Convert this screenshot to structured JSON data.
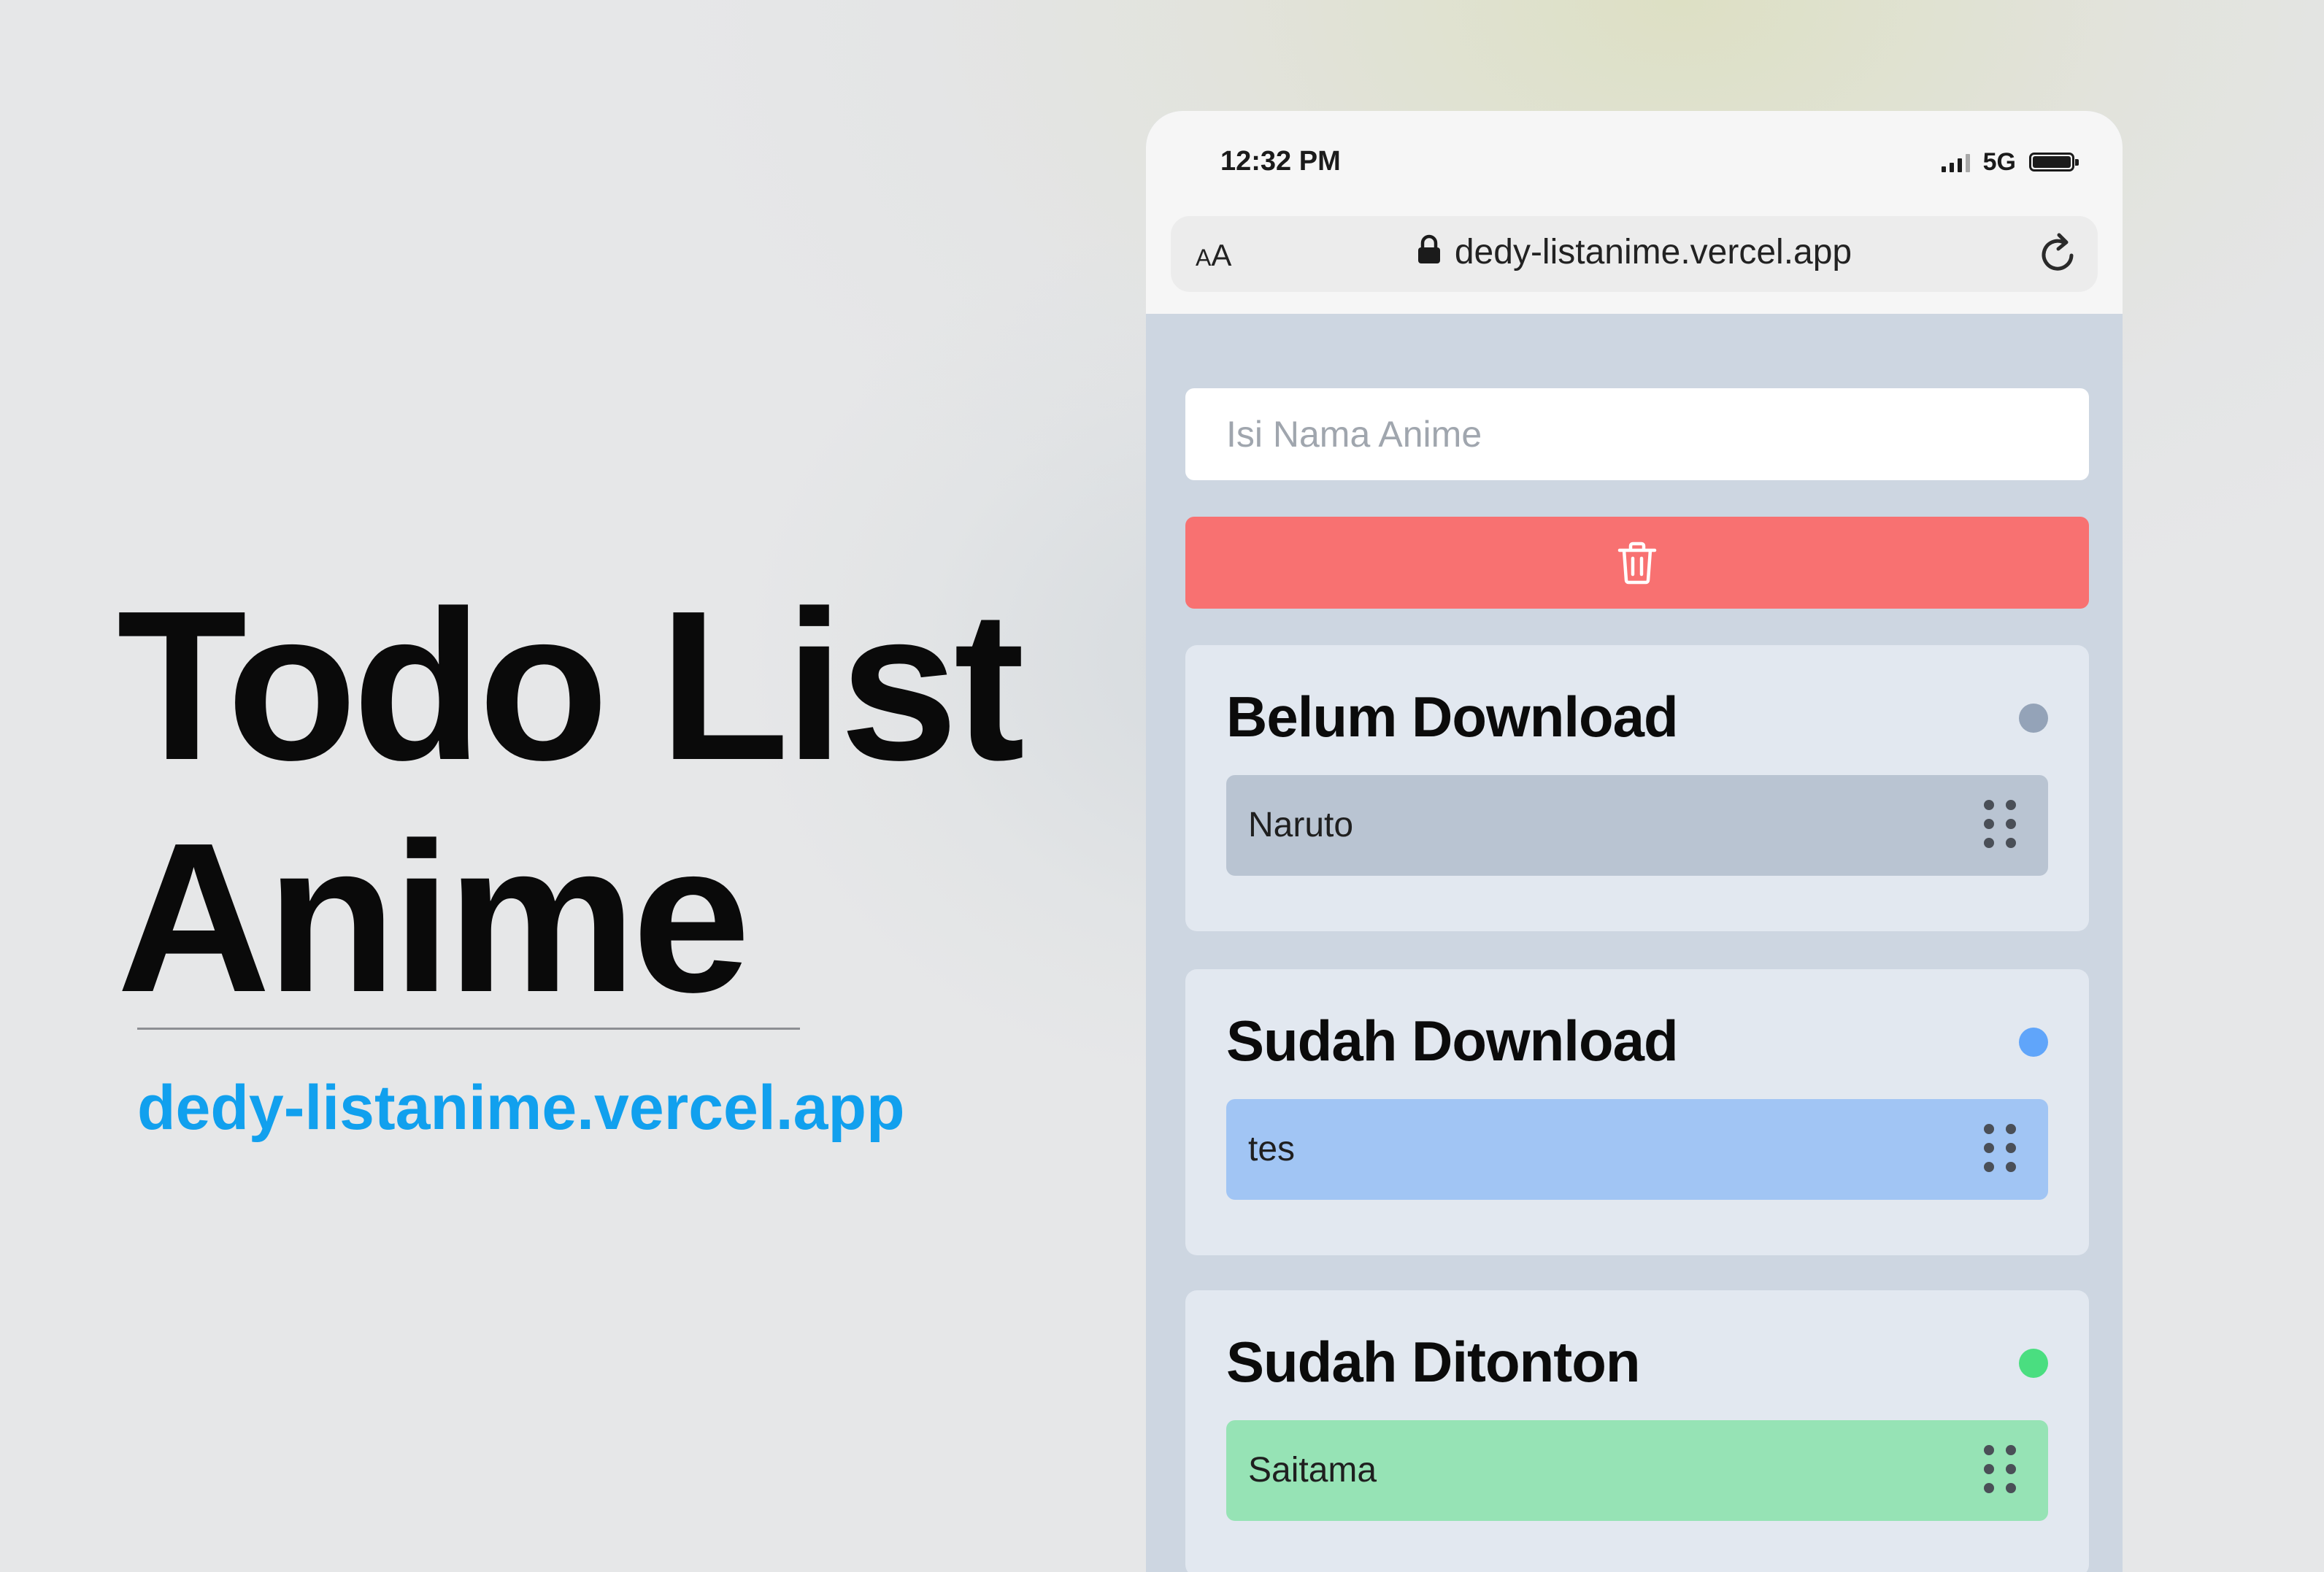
{
  "hero": {
    "title_line1": "Todo List",
    "title_line2": "Anime",
    "url": "dedy-listanime.vercel.app"
  },
  "phone": {
    "status_bar": {
      "time": "12:32 PM",
      "network": "5G",
      "icons": [
        "signal-icon",
        "battery-icon"
      ]
    },
    "browser": {
      "text_size_button": {
        "big": "A",
        "small": "A"
      },
      "url": "dedy-listanime.vercel.app",
      "icons": [
        "lock-icon",
        "reload-icon"
      ]
    },
    "app": {
      "input_placeholder": "Isi Nama Anime",
      "input_value": "",
      "delete_button_icon": "trash-icon",
      "boards": [
        {
          "title": "Belum Download",
          "dot_color": "#94a3b8",
          "item_color": "#b9c4d2",
          "items": [
            "Naruto"
          ]
        },
        {
          "title": "Sudah Download",
          "dot_color": "#60a5fa",
          "item_color": "#a1c5f4",
          "items": [
            "tes"
          ]
        },
        {
          "title": "Sudah Ditonton",
          "dot_color": "#4ade80",
          "item_color": "#96e3b5",
          "items": [
            "Saitama"
          ]
        }
      ]
    }
  },
  "colors": {
    "accent_url": "#11a0ee",
    "delete_red": "#f87171",
    "phone_background": "#cdd6e1",
    "card_background": "#e2e8f0"
  }
}
